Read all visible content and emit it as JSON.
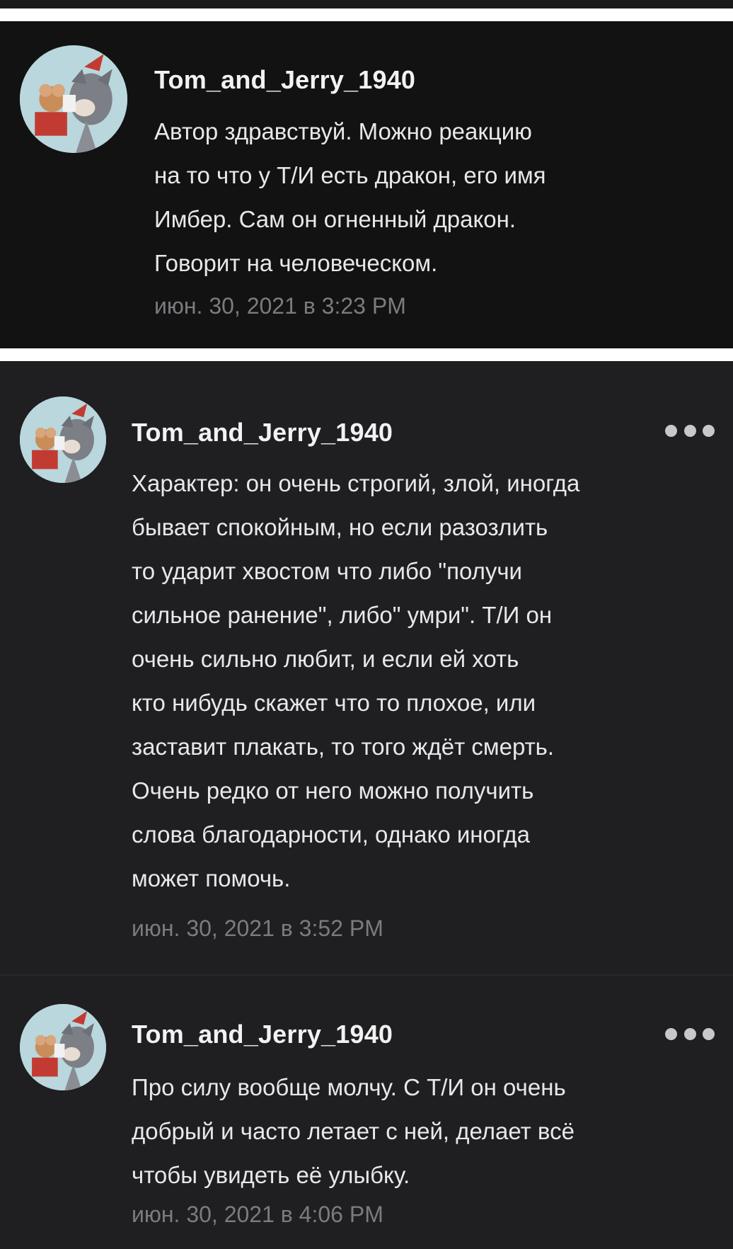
{
  "comments": [
    {
      "username": "Tom_and_Jerry_1940",
      "lines": [
        "Автор здравствуй. Можно реакцию",
        "на то что у Т/И есть дракон, его имя",
        "Имбер. Сам он огненный дракон.",
        "Говорит на человеческом."
      ],
      "timestamp": "июн. 30, 2021 в 3:23 PM"
    },
    {
      "username": "Tom_and_Jerry_1940",
      "lines": [
        "Характер: он очень строгий, злой, иногда",
        "бывает спокойным, но если разозлить",
        "то ударит хвостом что либо \"получи",
        "сильное ранение\", либо\" умри\". Т/И он",
        "очень сильно любит, и если ей хоть",
        "кто нибудь скажет что то плохое, или",
        "заставит плакать, то того ждёт смерть.",
        "Очень редко от него можно получить",
        "слова благодарности, однако иногда",
        "может помочь."
      ],
      "timestamp": "июн. 30, 2021 в 3:52 PM"
    },
    {
      "username": "Tom_and_Jerry_1940",
      "lines": [
        "Про силу вообще молчу. С Т/И он очень",
        "добрый и часто летает с ней, делает всё",
        "чтобы увидеть её улыбку."
      ],
      "timestamp": "июн. 30, 2021 в 4:06 PM"
    }
  ],
  "icons": {
    "avatar": "tom-and-jerry-avatar",
    "more": "more-options-icon"
  },
  "colors": {
    "panel_top": "#121212",
    "panel_bottom": "#1f1e21",
    "username": "#f2f2f2",
    "body": "#e8e8e8",
    "timestamp": "#7c7b80"
  }
}
